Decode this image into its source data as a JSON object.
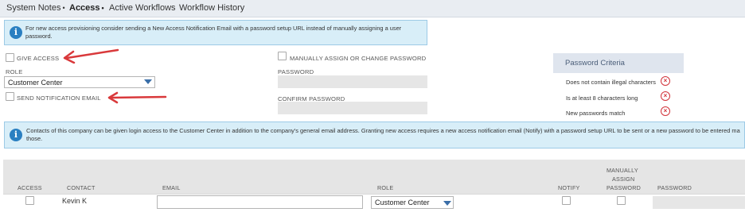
{
  "tabs": [
    {
      "label": "System Notes",
      "marker": "•"
    },
    {
      "label": "Access",
      "marker": "•"
    },
    {
      "label": "Active Workflows",
      "marker": ""
    },
    {
      "label": "Workflow History",
      "marker": ""
    }
  ],
  "top_banner": {
    "text": "For new access provisioning consider sending a New Access Notification Email with a password setup URL instead of manually assigning a user password."
  },
  "form": {
    "give_access_label": "GIVE ACCESS",
    "role_label": "ROLE",
    "role_value": "Customer Center",
    "send_notification_label": "SEND NOTIFICATION EMAIL",
    "manually_assign_label": "MANUALLY ASSIGN OR CHANGE PASSWORD",
    "password_label": "PASSWORD",
    "confirm_password_label": "CONFIRM PASSWORD"
  },
  "password_criteria": {
    "title": "Password Criteria",
    "items": [
      "Does not contain illegal characters",
      "Is at least 8 characters long",
      "New passwords match"
    ],
    "status_icon": "red-x-circle-icon"
  },
  "bottom_banner": {
    "text": "Contacts of this company can be given login access to the Customer Center in addition to the company's general email address. Granting new access requires a new access notification email (Notify) with a password setup URL to be sent or a new password to be entered ma those."
  },
  "grid": {
    "headers": {
      "access": "ACCESS",
      "contact": "CONTACT",
      "email": "EMAIL",
      "role": "ROLE",
      "notify": "NOTIFY",
      "manually_assign_l1": "MANUALLY",
      "manually_assign_l2": "ASSIGN",
      "manually_assign_l3": "PASSWORD",
      "password": "PASSWORD"
    },
    "rows": [
      {
        "contact": "Kevin K",
        "email": "",
        "role": "Customer Center"
      }
    ]
  },
  "colors": {
    "banner_bg": "#d8eef8",
    "info_icon": "#2a7fc1",
    "arrow": "#d9393b",
    "criteria_fail": "#d2333a"
  }
}
